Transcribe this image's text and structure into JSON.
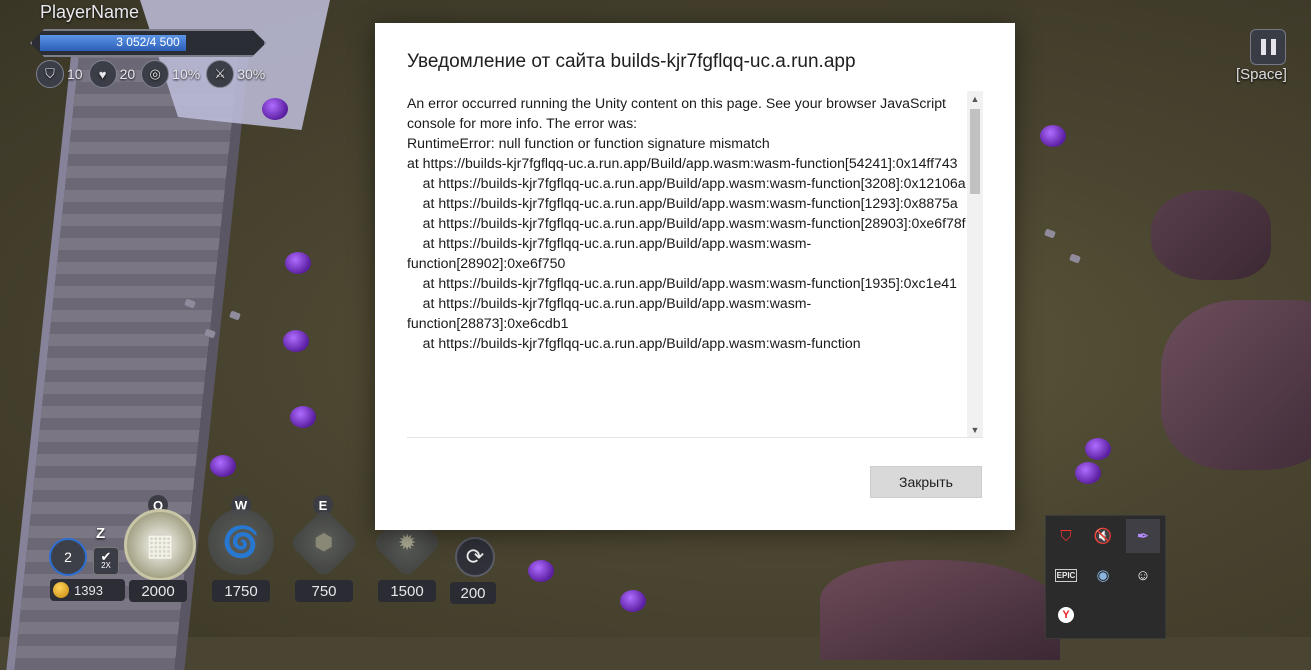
{
  "hud": {
    "player_name": "PlayerName",
    "hp_text": "3 052/4 500",
    "hp_fraction": 0.678,
    "stats": [
      {
        "icon": "shield-icon",
        "value": "10"
      },
      {
        "icon": "heart-icon",
        "value": "20"
      },
      {
        "icon": "target-icon",
        "value": "10%"
      },
      {
        "icon": "crossed-swords-icon",
        "value": "30%"
      }
    ],
    "pause_hint": "[Space]"
  },
  "abilities": {
    "wave": "2",
    "speed_key": "Z",
    "speed_label": "2X",
    "gold": "1393",
    "skills": [
      {
        "key": "Q",
        "cost": "2000"
      },
      {
        "key": "W",
        "cost": "1750"
      },
      {
        "key": "E",
        "cost": "750"
      },
      {
        "key": "",
        "cost": "1500"
      }
    ],
    "refresh_cost": "200"
  },
  "dialog": {
    "title": "Уведомление от сайта builds-kjr7fgflqq-uc.a.run.app",
    "message": "An error occurred running the Unity content on this page. See your browser JavaScript console for more info. The error was:\nRuntimeError: null function or function signature mismatch\nat https://builds-kjr7fgflqq-uc.a.run.app/Build/app.wasm:wasm-function[54241]:0x14ff743\n    at https://builds-kjr7fgflqq-uc.a.run.app/Build/app.wasm:wasm-function[3208]:0x12106a\n    at https://builds-kjr7fgflqq-uc.a.run.app/Build/app.wasm:wasm-function[1293]:0x8875a\n    at https://builds-kjr7fgflqq-uc.a.run.app/Build/app.wasm:wasm-function[28903]:0xe6f78f\n    at https://builds-kjr7fgflqq-uc.a.run.app/Build/app.wasm:wasm-function[28902]:0xe6f750\n    at https://builds-kjr7fgflqq-uc.a.run.app/Build/app.wasm:wasm-function[1935]:0xc1e41\n    at https://builds-kjr7fgflqq-uc.a.run.app/Build/app.wasm:wasm-function[28873]:0xe6cdb1\n    at https://builds-kjr7fgflqq-uc.a.run.app/Build/app.wasm:wasm-function",
    "close_label": "Закрыть"
  },
  "tray": {
    "items": [
      "antivirus-icon",
      "volume-muted-icon",
      "feather-app-icon",
      "epic-games-icon",
      "steam-icon",
      "discord-icon",
      "yandex-browser-icon"
    ]
  }
}
